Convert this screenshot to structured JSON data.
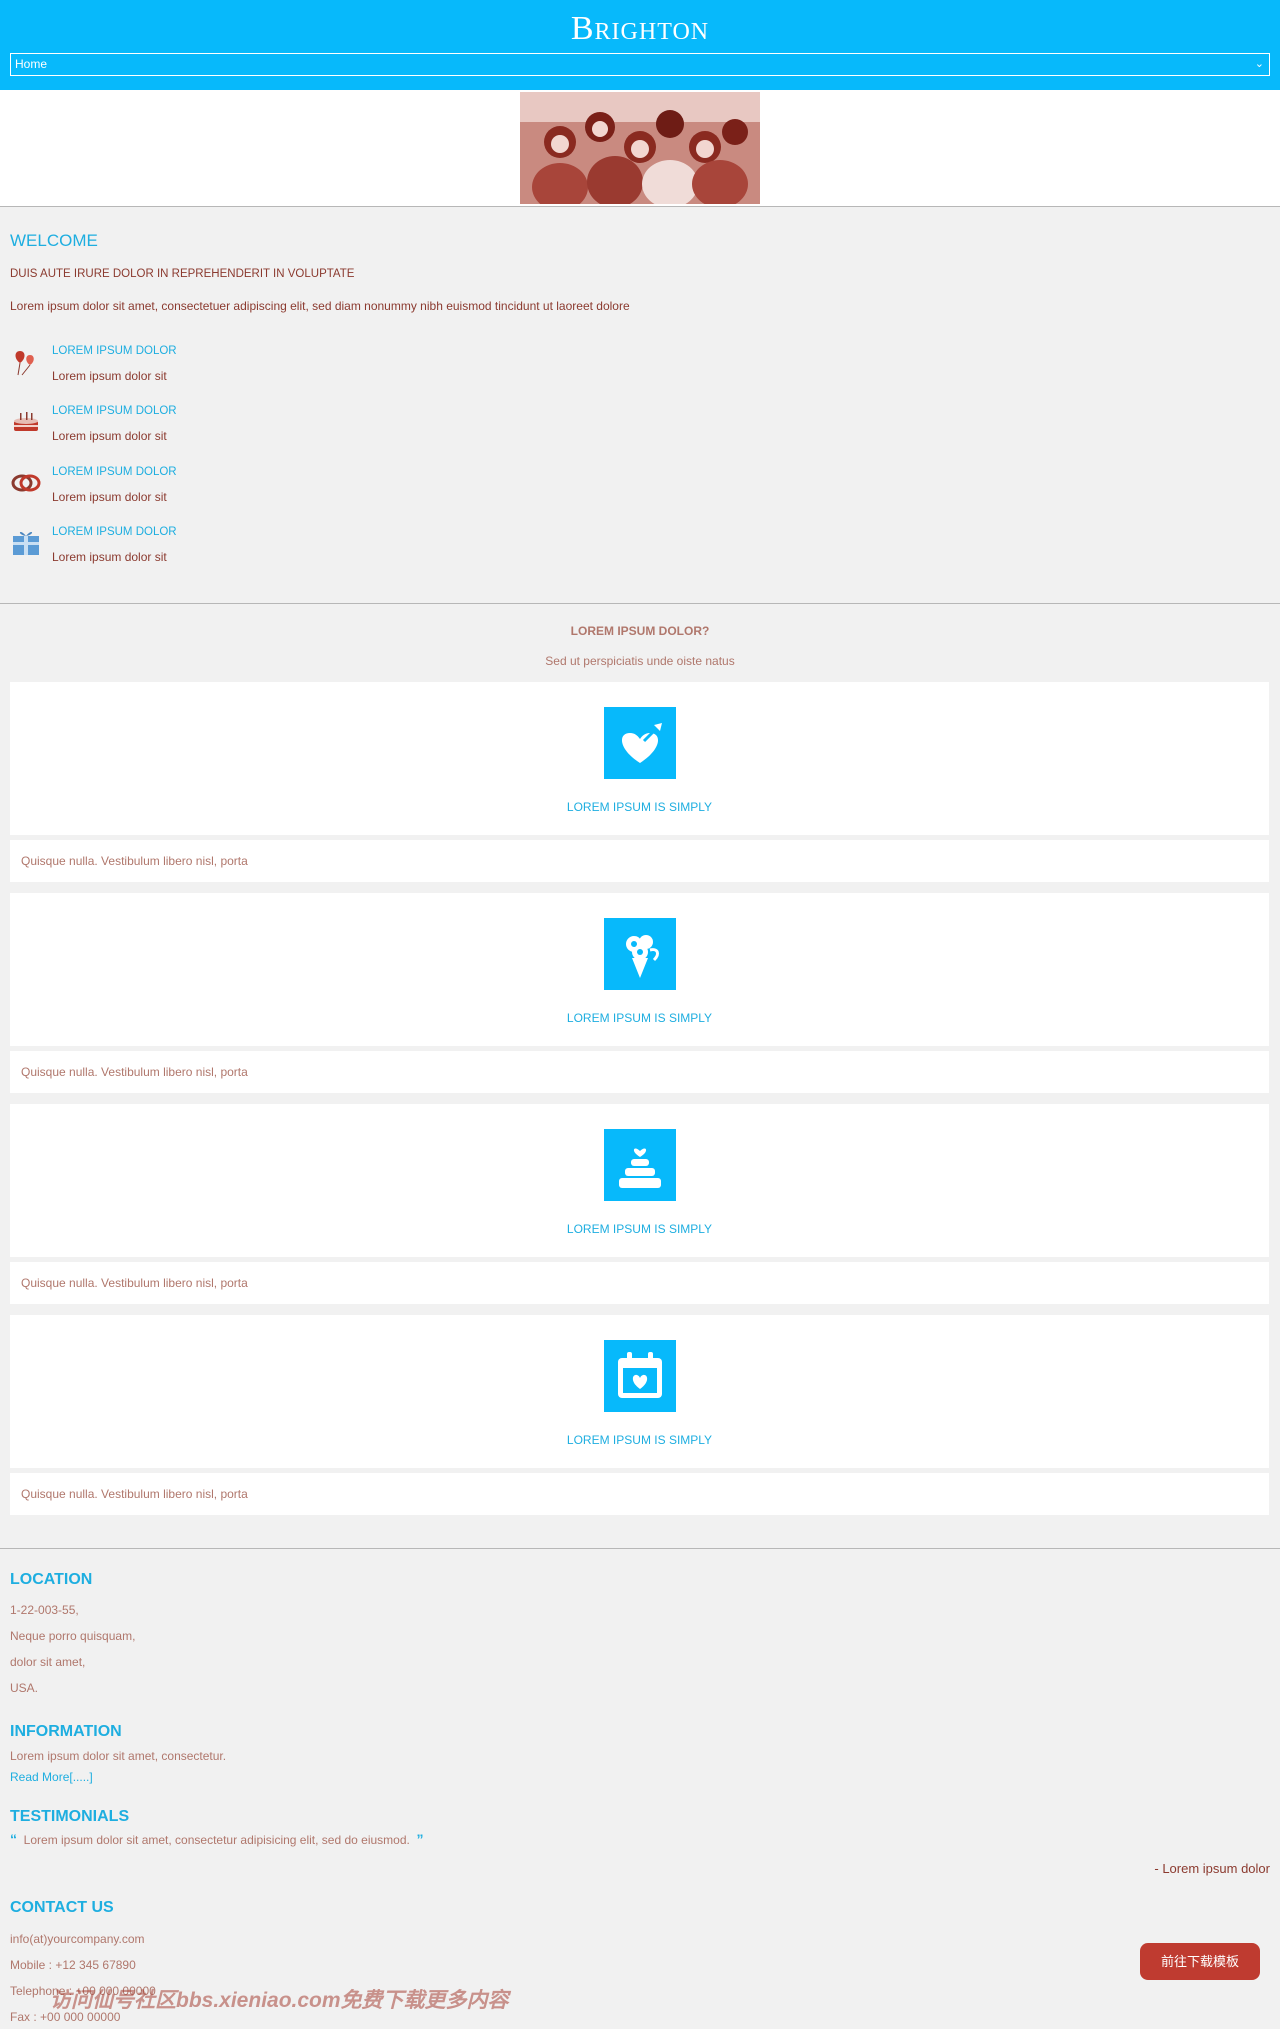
{
  "header": {
    "brand": "Brighton",
    "nav_selected": "Home"
  },
  "welcome": {
    "title": "WELCOME",
    "subtitle": "DUIS AUTE IRURE DOLOR IN REPREHENDERIT IN VOLUPTATE",
    "text": "Lorem ipsum dolor sit amet, consectetuer adipiscing elit, sed diam nonummy nibh euismod tincidunt ut laoreet dolore",
    "features": [
      {
        "icon": "balloons-icon",
        "title": "LOREM IPSUM DOLOR",
        "text": "Lorem ipsum dolor sit"
      },
      {
        "icon": "cake-icon",
        "title": "LOREM IPSUM DOLOR",
        "text": "Lorem ipsum dolor sit"
      },
      {
        "icon": "rings-icon",
        "title": "LOREM IPSUM DOLOR",
        "text": "Lorem ipsum dolor sit"
      },
      {
        "icon": "gift-icon",
        "title": "LOREM IPSUM DOLOR",
        "text": "Lorem ipsum dolor sit"
      }
    ]
  },
  "services": {
    "title": "LOREM IPSUM DOLOR?",
    "subtitle": "Sed ut perspiciatis unde oiste natus",
    "cards": [
      {
        "icon": "heart-arrow-icon",
        "title": "LOREM IPSUM IS SIMPLY",
        "text": "Quisque nulla. Vestibulum libero nisl, porta"
      },
      {
        "icon": "bouquet-icon",
        "title": "LOREM IPSUM IS SIMPLY",
        "text": "Quisque nulla. Vestibulum libero nisl, porta"
      },
      {
        "icon": "wedding-cake-icon",
        "title": "LOREM IPSUM IS SIMPLY",
        "text": "Quisque nulla. Vestibulum libero nisl, porta"
      },
      {
        "icon": "calendar-heart-icon",
        "title": "LOREM IPSUM IS SIMPLY",
        "text": "Quisque nulla. Vestibulum libero nisl, porta"
      }
    ]
  },
  "location": {
    "title": "LOCATION",
    "lines": [
      "1-22-003-55,",
      "Neque porro quisquam,",
      "dolor sit amet,",
      "USA."
    ]
  },
  "information": {
    "title": "INFORMATION",
    "text": "Lorem ipsum dolor sit amet, consectetur.",
    "link": "Read More[.....]"
  },
  "testimonials": {
    "title": "TESTIMONIALS",
    "open_quote": "“",
    "quote": "Lorem ipsum dolor sit amet, consectetur adipisicing elit, sed do eiusmod.",
    "close_quote": "”",
    "author": "- Lorem ipsum dolor"
  },
  "contact": {
    "title": "CONTACT US",
    "email": "info(at)yourcompany.com",
    "mobile": "Mobile : +12 345 67890",
    "telephone": "Telephone : +00 000 00000",
    "fax": "Fax : +00 000 00000"
  },
  "download_button": "前往下载模板",
  "watermark": "访问仙号社区bbs.xieniao.com免费下载更多内容",
  "colors": {
    "accent": "#07b9fb",
    "heading": "#1eaee0",
    "text": "#8b3a2f",
    "muted": "#b0776c",
    "button": "#bf3b30"
  }
}
